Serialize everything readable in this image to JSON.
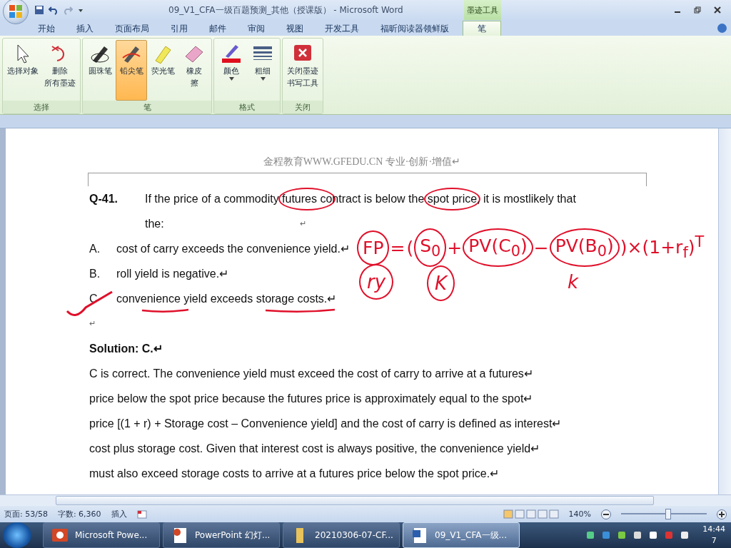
{
  "window": {
    "title": "09_V1_CFA一级百题预测_其他（授课版） - Microsoft Word",
    "context_tab": "墨迹工具"
  },
  "tabs": [
    {
      "label": "开始",
      "selected": false
    },
    {
      "label": "插入",
      "selected": false
    },
    {
      "label": "页面布局",
      "selected": false
    },
    {
      "label": "引用",
      "selected": false
    },
    {
      "label": "邮件",
      "selected": false
    },
    {
      "label": "审阅",
      "selected": false
    },
    {
      "label": "视图",
      "selected": false
    },
    {
      "label": "开发工具",
      "selected": false
    },
    {
      "label": "福昕阅读器领鲜版",
      "selected": false
    },
    {
      "label": "笔",
      "selected": true
    }
  ],
  "ribbon_groups": [
    {
      "label": "选择",
      "buttons": [
        {
          "lines": [
            "选择对象"
          ],
          "kind": "pointer",
          "selected": false
        },
        {
          "lines": [
            "删除",
            "所有墨迹"
          ],
          "kind": "erase-all",
          "selected": false
        }
      ]
    },
    {
      "label": "笔",
      "buttons": [
        {
          "lines": [
            "圆珠笔"
          ],
          "kind": "ballpoint",
          "selected": false
        },
        {
          "lines": [
            "铅尖笔"
          ],
          "kind": "felt",
          "selected": true
        },
        {
          "lines": [
            "荧光笔"
          ],
          "kind": "highlighter",
          "selected": false
        },
        {
          "lines": [
            "橡皮",
            "擦"
          ],
          "kind": "eraser",
          "selected": false
        }
      ]
    },
    {
      "label": "格式",
      "buttons": [
        {
          "lines": [
            "颜色"
          ],
          "kind": "color",
          "selected": false,
          "dropdown": true
        },
        {
          "lines": [
            "粗细"
          ],
          "kind": "weight",
          "selected": false,
          "dropdown": true
        }
      ]
    },
    {
      "label": "关闭",
      "buttons": [
        {
          "lines": [
            "关闭墨迹",
            "书写工具"
          ],
          "kind": "close",
          "selected": false
        }
      ]
    }
  ],
  "document": {
    "header": "金程教育WWW.GFEDU.CN 专业·创新·增值↵",
    "question": {
      "number": "Q-41.",
      "first_line": [
        {
          "text": "If the price of a commodity ",
          "circled": false
        },
        {
          "text": "futures co",
          "circled": true
        },
        {
          "text": "ntract is below the ",
          "circled": false
        },
        {
          "text": "spot price",
          "circled": true
        },
        {
          "text": ", it is mostlikely that",
          "circled": false
        }
      ],
      "second_line": "the:",
      "mark": "↵"
    },
    "options": [
      {
        "letter": "A.",
        "text": "cost of carry exceeds the convenience yield.↵"
      },
      {
        "letter": "B.",
        "text": "roll yield is negative.↵"
      },
      {
        "letter": "C",
        "text": "convenience yield exceeds storage costs.↵"
      }
    ],
    "empty_mark": "↵",
    "solution_title": "Solution: C.↵",
    "solution_lines": [
      "C is correct. The convenience yield must exceed the cost of carry to arrive at a futures↵",
      "price below the spot price because the futures price is approximately equal to the spot↵",
      "price [(1 + r) + Storage cost – Convenience yield] and the cost of carry is defined as interest↵",
      "cost plus storage cost. Given that interest cost is always positive, the convenience yield↵",
      "must also exceed storage costs to arrive at a futures price below the spot price.↵"
    ],
    "ink": {
      "formula": [
        {
          "text": "FP",
          "circled": true
        },
        {
          "text": "=",
          "circled": false
        },
        {
          "text": "(",
          "circled": false
        },
        {
          "text": "S$_{0}$",
          "circled": true
        },
        {
          "text": "+",
          "circled": false
        },
        {
          "text": "PV(C$_{0}$)",
          "circled": true
        },
        {
          "text": "−",
          "circled": false
        },
        {
          "text": "PV(B$_{0}$)",
          "circled": true
        },
        {
          "text": ")×(1+r$_{f}$)$^{T}$",
          "circled": false
        }
      ],
      "notes": [
        {
          "text": "ry",
          "circled": true
        },
        {
          "text": "K",
          "circled": true
        },
        {
          "text": "k",
          "circled": false
        }
      ]
    }
  },
  "status_bar": {
    "page": "页面: 53/58",
    "words": "字数: 6,360",
    "mode": "插入",
    "zoom": "140%",
    "zoom_level": {
      "level": 0.55
    }
  },
  "taskbar": {
    "items": [
      {
        "label": "Microsoft Powe...",
        "kind": "powerpoint",
        "selected": false
      },
      {
        "label": "PowerPoint 幻灯...",
        "kind": "slide",
        "selected": false
      },
      {
        "label": "20210306-07-CF...",
        "kind": "folder",
        "selected": false
      },
      {
        "label": "09_V1_CFA一级...",
        "kind": "word",
        "selected": true
      }
    ],
    "time": "14:44",
    "date": "7"
  }
}
